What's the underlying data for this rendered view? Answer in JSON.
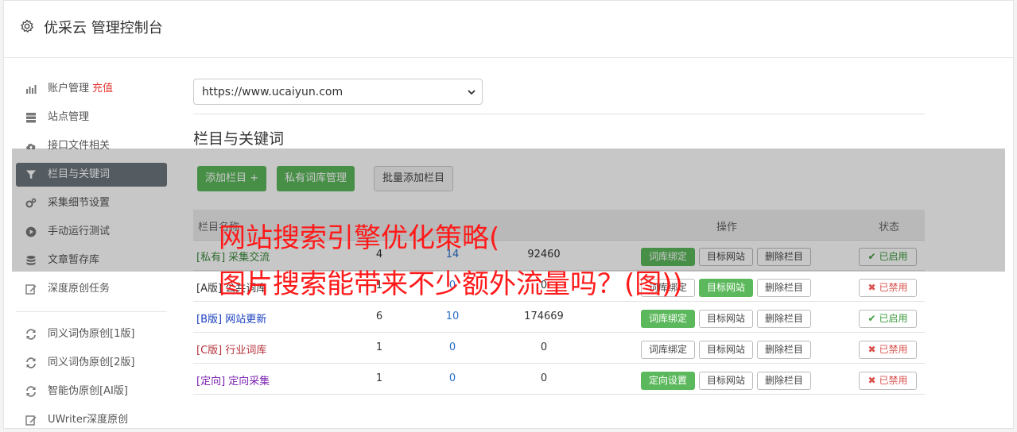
{
  "header": {
    "title": "优采云 管理控制台"
  },
  "sidebar": {
    "items": [
      {
        "label": "账户管理",
        "extra": "充值",
        "icon": "bar-chart-icon"
      },
      {
        "label": "站点管理",
        "icon": "server-icon"
      },
      {
        "label": "接口文件相关",
        "icon": "cloud-upload-icon"
      },
      {
        "label": "栏目与关键词",
        "icon": "filter-icon",
        "active": true
      },
      {
        "label": "采集细节设置",
        "icon": "cogs-icon"
      },
      {
        "label": "手动运行测试",
        "icon": "play-icon"
      },
      {
        "label": "文章暂存库",
        "icon": "database-icon"
      },
      {
        "label": "深度原创任务",
        "icon": "edit-icon"
      },
      {
        "label": "同义词伪原创[1版]",
        "icon": "refresh-icon"
      },
      {
        "label": "同义词伪原创[2版]",
        "icon": "refresh-icon"
      },
      {
        "label": "智能伪原创[AI版]",
        "icon": "refresh-icon"
      },
      {
        "label": "UWriter深度原创",
        "icon": "edit-icon"
      }
    ]
  },
  "site_select": {
    "value": "https://www.ucaiyun.com"
  },
  "section": {
    "title": "栏目与关键词"
  },
  "toolbar": {
    "add_column": "添加栏目 +",
    "private_lib": "私有词库管理",
    "batch_add": "批量添加栏目"
  },
  "table": {
    "headers": [
      "栏目名称",
      "",
      "",
      "",
      "操作",
      "状态"
    ],
    "rows": [
      {
        "tag": "[私有]",
        "name": "采集交流",
        "c1": "4",
        "c2": "14",
        "c3": "92460",
        "op1": "词库绑定",
        "op1_green": true,
        "op2": "目标网站",
        "op3": "删除栏目",
        "status": "已启用",
        "on": true,
        "color": "#3c8a3c"
      },
      {
        "tag": "[A版]",
        "name": "公共词库",
        "c1": "1",
        "c2": "0",
        "c3": "0",
        "op1": "词库绑定",
        "op1_green": false,
        "op2": "目标网站",
        "op2_green": true,
        "op3": "删除栏目",
        "status": "已禁用",
        "on": false,
        "color": "#333333"
      },
      {
        "tag": "[B版]",
        "name": "网站更新",
        "c1": "6",
        "c2": "10",
        "c3": "174669",
        "op1": "词库绑定",
        "op1_green": true,
        "op2": "目标网站",
        "op3": "删除栏目",
        "status": "已启用",
        "on": true,
        "color": "#1a3fbf"
      },
      {
        "tag": "[C版]",
        "name": "行业词库",
        "c1": "1",
        "c2": "0",
        "c3": "0",
        "op1": "词库绑定",
        "op1_green": false,
        "op2": "目标网站",
        "op3": "删除栏目",
        "status": "已禁用",
        "on": false,
        "color": "#b5323a"
      },
      {
        "tag": "[定向]",
        "name": "定向采集",
        "c1": "1",
        "c2": "0",
        "c3": "0",
        "op1": "定向设置",
        "op1_green": true,
        "op2": "目标网站",
        "op3": "删除栏目",
        "status": "已禁用",
        "on": false,
        "color": "#7a22b0"
      }
    ]
  },
  "watermark": {
    "line1": "网站搜索引擎优化策略(",
    "line2": "图片搜索能带来不少额外流量吗？(图))"
  }
}
